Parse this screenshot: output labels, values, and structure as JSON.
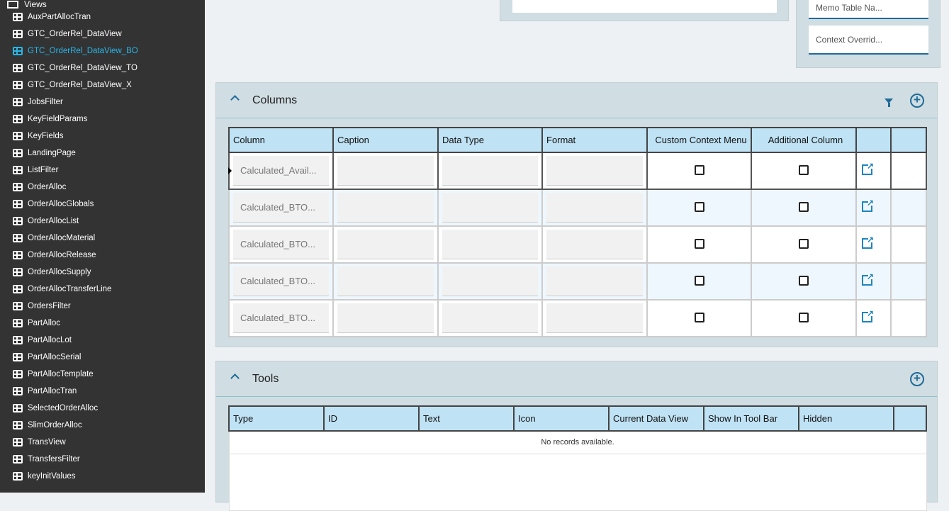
{
  "sidebar": {
    "group": "Views",
    "selected": "GTC_OrderRel_DataView_BO",
    "items": [
      "AuxPartAllocTran",
      "GTC_OrderRel_DataView",
      "GTC_OrderRel_DataView_BO",
      "GTC_OrderRel_DataView_TO",
      "GTC_OrderRel_DataView_X",
      "JobsFilter",
      "KeyFieldParams",
      "KeyFields",
      "LandingPage",
      "ListFilter",
      "OrderAlloc",
      "OrderAllocGlobals",
      "OrderAllocList",
      "OrderAllocMaterial",
      "OrderAllocRelease",
      "OrderAllocSupply",
      "OrderAllocTransferLine",
      "OrdersFilter",
      "PartAlloc",
      "PartAllocLot",
      "PartAllocSerial",
      "PartAllocTemplate",
      "PartAllocTran",
      "SelectedOrderAlloc",
      "SlimOrderAlloc",
      "TransView",
      "TransfersFilter",
      "keyInitValues"
    ]
  },
  "top": {
    "memo_table": "Memo Table Na...",
    "context_override": "Context Overrid..."
  },
  "columns": {
    "title": "Columns",
    "headers": [
      "Column",
      "Caption",
      "Data Type",
      "Format",
      "Custom Context Menu",
      "Additional Column",
      "",
      ""
    ],
    "rows": [
      {
        "column": "Calculated_Avail..."
      },
      {
        "column": "Calculated_BTO..."
      },
      {
        "column": "Calculated_BTO..."
      },
      {
        "column": "Calculated_BTO..."
      },
      {
        "column": "Calculated_BTO..."
      }
    ]
  },
  "tools": {
    "title": "Tools",
    "headers": [
      "Type",
      "ID",
      "Text",
      "Icon",
      "Current Data View",
      "Show In Tool Bar",
      "Hidden",
      ""
    ],
    "empty": "No records available."
  },
  "colors": {
    "accent": "#1f6b99",
    "selected": "#29b6e8",
    "header": "#bfe2f4"
  }
}
